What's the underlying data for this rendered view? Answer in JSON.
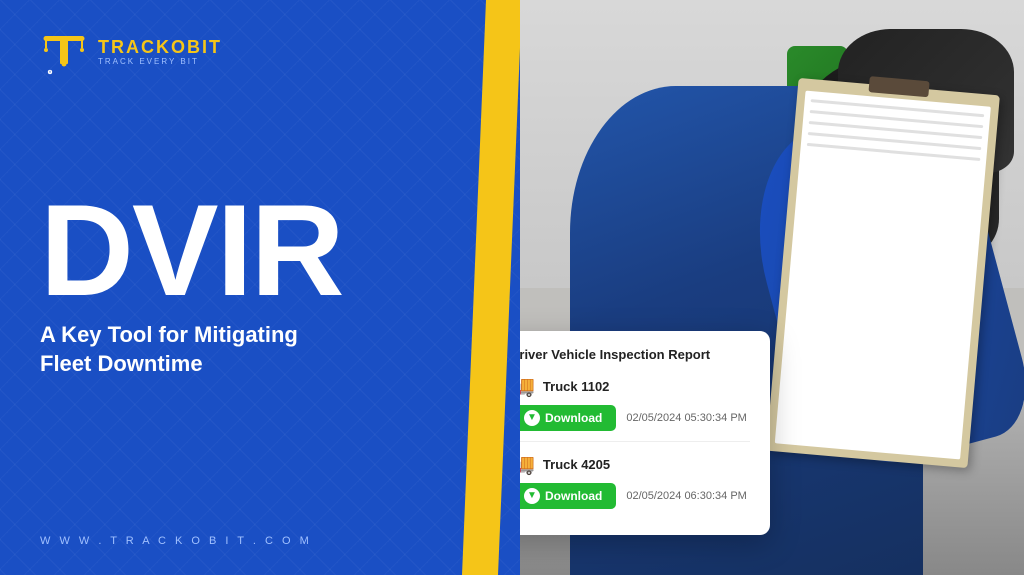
{
  "brand": {
    "name_part1": "TRACKO",
    "name_part2": "BIT",
    "tagline": "TRACK EVERY BIT",
    "website": "W W W . T R A C K O B I T . C O M"
  },
  "hero": {
    "title": "DVIR",
    "subtitle_line1": "A Key Tool for Mitigating",
    "subtitle_line2": "Fleet Downtime"
  },
  "report_card": {
    "title": "Driver Vehicle Inspection Report",
    "entries": [
      {
        "truck_label": "Truck 1102",
        "download_label": "Download",
        "timestamp": "02/05/2024  05:30:34 PM"
      },
      {
        "truck_label": "Truck 4205",
        "download_label": "Download",
        "timestamp": "02/05/2024  06:30:34 PM"
      }
    ]
  },
  "colors": {
    "blue": "#1a4fc4",
    "yellow": "#f5c518",
    "green": "#22bb33",
    "white": "#ffffff"
  }
}
